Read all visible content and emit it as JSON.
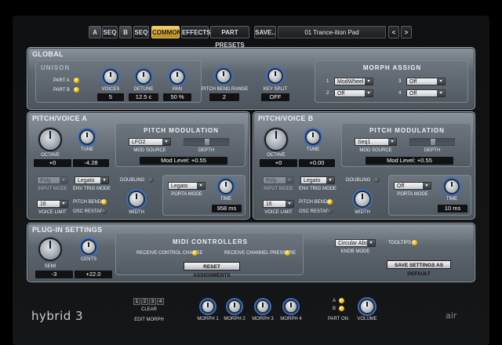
{
  "topbar": {
    "part_a": "A",
    "seq_a": "SEQ",
    "part_b": "B",
    "seq_b": "SEQ",
    "common": "COMMON",
    "effects": "EFFECTS",
    "part_presets": "PART PRESETS",
    "save": "SAVE..",
    "preset_name": "01 Trance-ition Pad",
    "prev": "<",
    "next": ">"
  },
  "global": {
    "title": "GLOBAL",
    "unison": {
      "title": "UNISON",
      "part_a": "PART A",
      "part_b": "PART B",
      "voices_label": "VOICES",
      "voices": "5",
      "detune_label": "DETUNE",
      "detune": "12.5 c",
      "pan_label": "PAN",
      "pan": "50 %"
    },
    "pitch_bend_range_label": "PITCH BEND RANGE",
    "pitch_bend_range": "2",
    "key_split_label": "KEY SPLIT",
    "key_split": "OFF",
    "morph_assign": {
      "title": "MORPH ASSIGN",
      "slots": [
        {
          "num": "1",
          "value": "ModWheel"
        },
        {
          "num": "2",
          "value": "Off"
        },
        {
          "num": "3",
          "value": "Off"
        },
        {
          "num": "4",
          "value": "Off"
        }
      ]
    }
  },
  "voice_a": {
    "title": "PITCH/VOICE A",
    "octave_label": "OCTAVE",
    "octave": "+0",
    "tune_label": "TUNE",
    "tune": "-4.28",
    "pitch_mod_title": "PITCH MODULATION",
    "mod_source": "LFO2",
    "mod_source_label": "MOD SOURCE",
    "depth_label": "DEPTH",
    "mod_level": "Mod Level: +0.55",
    "input_mode_value": "Poly",
    "input_mode_label": "INPUT MODE",
    "env_trig": "Legato",
    "env_trig_label": "ENV TRIG MODE",
    "voice_limit": "16",
    "voice_limit_label": "VOICE LIMIT",
    "pitch_bend_label": "PITCH BEND",
    "osc_restart_label": "OSC RESTART",
    "doubling_label": "DOUBLING",
    "width_label": "WIDTH",
    "porta_mode": "Legato",
    "porta_mode_label": "PORTA MODE",
    "time_label": "TIME",
    "time": "958 ms"
  },
  "voice_b": {
    "title": "PITCH/VOICE B",
    "octave_label": "OCTAVE",
    "octave": "+0",
    "tune_label": "TUNE",
    "tune": "+0.00",
    "pitch_mod_title": "PITCH MODULATION",
    "mod_source": "Seq1",
    "mod_source_label": "MOD SOURCE",
    "depth_label": "DEPTH",
    "mod_level": "Mod Level: +0.55",
    "input_mode_value": "Poly",
    "input_mode_label": "INPUT MODE",
    "env_trig": "Legato",
    "env_trig_label": "ENV TRIG MODE",
    "voice_limit": "16",
    "voice_limit_label": "VOICE LIMIT",
    "pitch_bend_label": "PITCH BEND",
    "osc_restart_label": "OSC RESTART",
    "doubling_label": "DOUBLING",
    "width_label": "WIDTH",
    "porta_mode": "Off",
    "porta_mode_label": "PORTA MODE",
    "time_label": "TIME",
    "time": "10 ms"
  },
  "plugin": {
    "title": "PLUG-IN SETTINGS",
    "semi_label": "SEMI",
    "semi": "-3",
    "cents_label": "CENTS",
    "cents": "+22.0",
    "midi_title": "MIDI CONTROLLERS",
    "receive_cc": "RECEIVE CONTROL CHANGE",
    "receive_pressure": "RECEIVE CHANNEL PRESSURE",
    "reset": "RESET ASSIGNMENTS",
    "knob_mode": "Circular Abs",
    "knob_mode_label": "KNOB MODE",
    "tooltips": "TOOLTIPS",
    "save_default": "SAVE SETTINGS AS DEFAULT"
  },
  "bottom": {
    "logo": "hybrid 3",
    "brand": "air",
    "morph_nums": [
      "1",
      "2",
      "3",
      "4"
    ],
    "clear": "CLEAR",
    "edit_morph": "EDIT MORPH",
    "morph1": "MORPH 1",
    "morph2": "MORPH 2",
    "morph3": "MORPH 3",
    "morph4": "MORPH 4",
    "part_a": "A",
    "part_b": "B",
    "part_on": "PART ON",
    "volume": "VOLUME"
  }
}
